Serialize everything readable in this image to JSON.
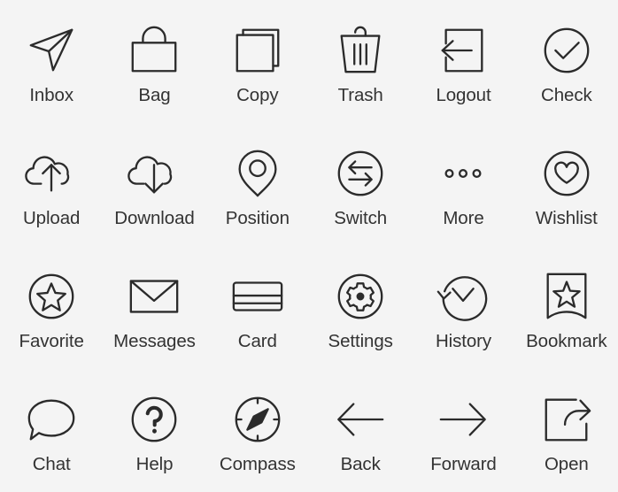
{
  "page": {
    "title": "Icon Set Grid",
    "background_color": "#f4f4f4",
    "stroke_color": "#2b2b2b",
    "label_color": "#333333",
    "columns": 6,
    "rows": 4,
    "icon_count": 24
  },
  "icons": [
    {
      "name": "inbox",
      "label": "Inbox",
      "glyph": "paper-plane-icon"
    },
    {
      "name": "bag",
      "label": "Bag",
      "glyph": "shopping-bag-icon"
    },
    {
      "name": "copy",
      "label": "Copy",
      "glyph": "copy-pages-icon"
    },
    {
      "name": "trash",
      "label": "Trash",
      "glyph": "trash-can-icon"
    },
    {
      "name": "logout",
      "label": "Logout",
      "glyph": "logout-arrow-icon"
    },
    {
      "name": "check",
      "label": "Check",
      "glyph": "check-circle-icon"
    },
    {
      "name": "upload",
      "label": "Upload",
      "glyph": "cloud-upload-icon"
    },
    {
      "name": "download",
      "label": "Download",
      "glyph": "cloud-download-icon"
    },
    {
      "name": "position",
      "label": "Position",
      "glyph": "map-pin-icon"
    },
    {
      "name": "switch",
      "label": "Switch",
      "glyph": "switch-arrows-circle-icon"
    },
    {
      "name": "more",
      "label": "More",
      "glyph": "ellipsis-icon"
    },
    {
      "name": "wishlist",
      "label": "Wishlist",
      "glyph": "heart-circle-icon"
    },
    {
      "name": "favorite",
      "label": "Favorite",
      "glyph": "star-circle-icon"
    },
    {
      "name": "messages",
      "label": "Messages",
      "glyph": "envelope-icon"
    },
    {
      "name": "card",
      "label": "Card",
      "glyph": "credit-card-icon"
    },
    {
      "name": "settings",
      "label": "Settings",
      "glyph": "gear-circle-icon"
    },
    {
      "name": "history",
      "label": "History",
      "glyph": "clock-rotate-icon"
    },
    {
      "name": "bookmark",
      "label": "Bookmark",
      "glyph": "bookmark-star-icon"
    },
    {
      "name": "chat",
      "label": "Chat",
      "glyph": "speech-bubble-icon"
    },
    {
      "name": "help",
      "label": "Help",
      "glyph": "question-circle-icon"
    },
    {
      "name": "compass",
      "label": "Compass",
      "glyph": "compass-icon"
    },
    {
      "name": "back",
      "label": "Back",
      "glyph": "arrow-left-icon"
    },
    {
      "name": "forward",
      "label": "Forward",
      "glyph": "arrow-right-icon"
    },
    {
      "name": "open",
      "label": "Open",
      "glyph": "open-external-icon"
    }
  ]
}
